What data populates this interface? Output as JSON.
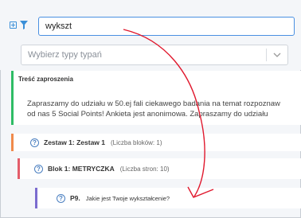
{
  "search": {
    "value": "wykszt"
  },
  "type_select": {
    "placeholder": "Wybierz typy typań"
  },
  "invite": {
    "title": "Treść zaproszenia",
    "body_line1": "Zapraszamy do udziału w 50.ej fali ciekawego badania na temat rozpoznaw",
    "body_line2": "od nas 5 Social Points!  Ankieta jest anonimowa.   Zapraszamy do udziału"
  },
  "set": {
    "label": "Zestaw 1:  Zestaw 1",
    "meta": "(Liczba bloków: 1)"
  },
  "block": {
    "label": "Blok 1:  METRYCZKA",
    "meta": "(Liczba stron: 10)"
  },
  "question": {
    "label": "P9.",
    "text": "Jakie jest Twoje wykształcenie?"
  },
  "colors": {
    "accent": "#4a90e2",
    "invite_border": "#2ebc65",
    "set_border": "#f08a4b",
    "block_border": "#e35d6a",
    "question_border": "#7b6ccf",
    "annotation_arrow": "#e0182d"
  },
  "icons": {
    "expand": "plus-square-icon",
    "filter": "filter-icon",
    "select": "chevron-down-icon",
    "help": "question-circle-icon"
  }
}
